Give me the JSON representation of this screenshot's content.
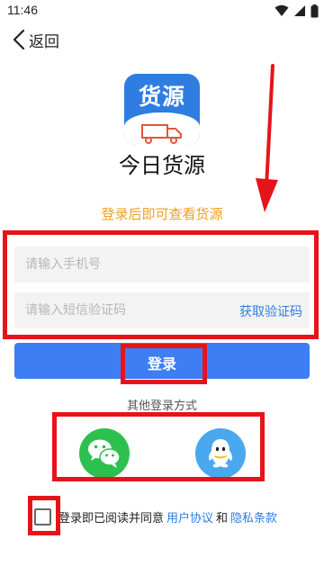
{
  "status_bar": {
    "time": "11:46",
    "icons": [
      "wifi-icon",
      "signal-icon",
      "battery-icon"
    ]
  },
  "nav": {
    "back_label": "返回",
    "back_icon": "chevron-left-icon"
  },
  "app": {
    "logo_text": "货源",
    "logo_color": "#2f7de1",
    "name": "今日货源"
  },
  "tip_text": "登录后即可查看货源",
  "form": {
    "phone_placeholder": "请输入手机号",
    "phone_value": "",
    "code_placeholder": "请输入短信验证码",
    "code_value": "",
    "get_code_label": "获取验证码"
  },
  "login_button_label": "登录",
  "other_login": {
    "label": "其他登录方式",
    "methods": [
      "wechat-icon",
      "qq-icon"
    ]
  },
  "agreement": {
    "checked": false,
    "text": "登录即已阅读并同意",
    "user_agreement": "用户协议",
    "and": "和",
    "privacy_policy": "隐私条款"
  },
  "colors": {
    "accent": "#3d7ef4",
    "tip": "#f0a020",
    "link": "#2f7de1",
    "annotation": "#e5141b",
    "wechat": "#2dc04f",
    "qq": "#4aa8ef"
  }
}
